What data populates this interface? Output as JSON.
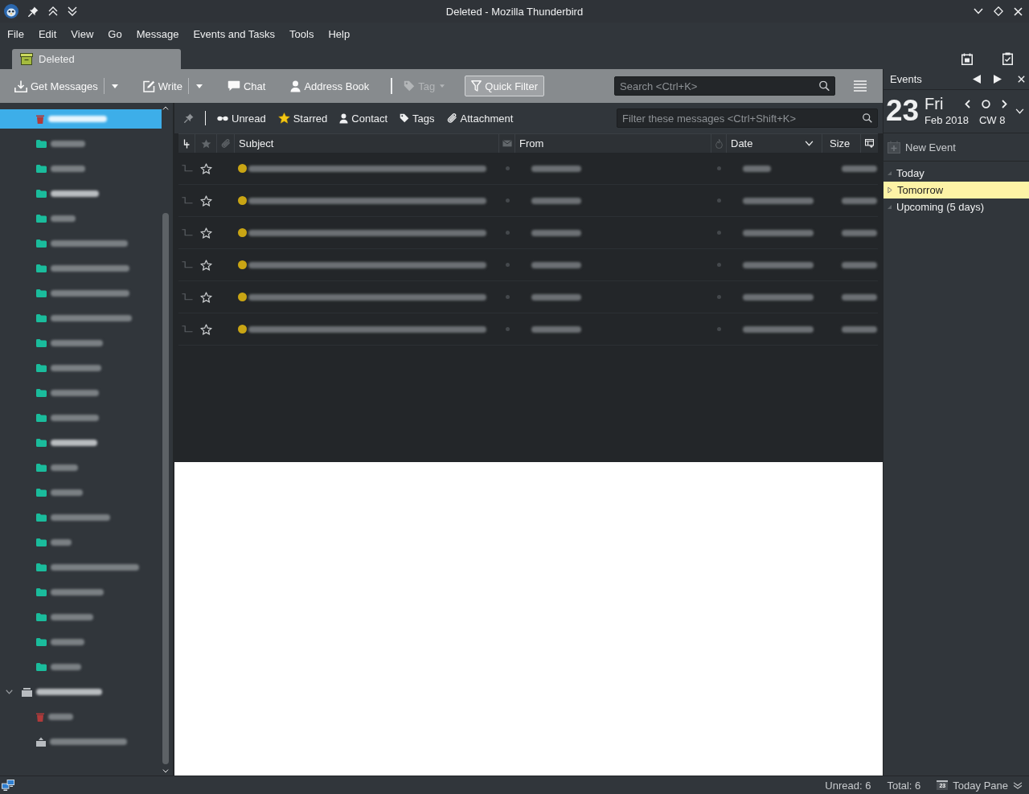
{
  "window": {
    "title": "Deleted - Mozilla Thunderbird"
  },
  "menu": [
    {
      "label": "File"
    },
    {
      "label": "Edit"
    },
    {
      "label": "View"
    },
    {
      "label": "Go"
    },
    {
      "label": "Message"
    },
    {
      "label": "Events and Tasks"
    },
    {
      "label": "Tools"
    },
    {
      "label": "Help"
    }
  ],
  "tabs": [
    {
      "label": "Deleted",
      "selected": true
    }
  ],
  "toolbar": {
    "items": [
      {
        "kind": "button",
        "label": "Get Messages",
        "split_menu": true,
        "dropdown": false,
        "disabled": false,
        "pressed": false
      },
      {
        "kind": "button",
        "label": "Write",
        "split_menu": true,
        "dropdown": false,
        "disabled": false,
        "pressed": false
      },
      {
        "kind": "button",
        "label": "Chat",
        "split_menu": false,
        "dropdown": false,
        "disabled": false,
        "pressed": false
      },
      {
        "kind": "button",
        "label": "Address Book",
        "split_menu": false,
        "dropdown": false,
        "disabled": false,
        "pressed": false
      },
      {
        "kind": "separator"
      },
      {
        "kind": "button",
        "label": "Tag",
        "split_menu": false,
        "dropdown": true,
        "disabled": true,
        "pressed": false
      },
      {
        "kind": "button",
        "label": "Quick Filter",
        "split_menu": false,
        "dropdown": false,
        "disabled": false,
        "pressed": true
      }
    ],
    "search": {
      "placeholder": "Search <Ctrl+K>"
    }
  },
  "folder_pane": {
    "folders": [
      {
        "kind": "trash",
        "selected": true,
        "unread": true
      },
      {
        "kind": "folder",
        "selected": false,
        "unread": false
      },
      {
        "kind": "folder",
        "selected": false,
        "unread": false
      },
      {
        "kind": "folder",
        "selected": false,
        "unread": true
      },
      {
        "kind": "folder",
        "selected": false,
        "unread": false
      },
      {
        "kind": "folder",
        "selected": false,
        "unread": false
      },
      {
        "kind": "folder",
        "selected": false,
        "unread": false
      },
      {
        "kind": "folder",
        "selected": false,
        "unread": false
      },
      {
        "kind": "folder",
        "selected": false,
        "unread": false
      },
      {
        "kind": "folder",
        "selected": false,
        "unread": false
      },
      {
        "kind": "folder",
        "selected": false,
        "unread": false
      },
      {
        "kind": "folder",
        "selected": false,
        "unread": false
      },
      {
        "kind": "folder",
        "selected": false,
        "unread": false
      },
      {
        "kind": "folder",
        "selected": false,
        "unread": true
      },
      {
        "kind": "folder",
        "selected": false,
        "unread": false
      },
      {
        "kind": "folder",
        "selected": false,
        "unread": false
      },
      {
        "kind": "folder",
        "selected": false,
        "unread": false
      },
      {
        "kind": "folder",
        "selected": false,
        "unread": false
      },
      {
        "kind": "folder",
        "selected": false,
        "unread": false
      },
      {
        "kind": "folder",
        "selected": false,
        "unread": false
      },
      {
        "kind": "folder",
        "selected": false,
        "unread": false
      },
      {
        "kind": "folder",
        "selected": false,
        "unread": false
      },
      {
        "kind": "folder",
        "selected": false,
        "unread": false
      }
    ],
    "accounts": [
      {
        "kind": "account",
        "selected": false,
        "expanded": true,
        "children": [
          {
            "kind": "trash",
            "selected": false,
            "unread": false
          },
          {
            "kind": "outbox",
            "selected": false,
            "unread": false
          }
        ]
      }
    ]
  },
  "quick_filter": {
    "buttons": [
      {
        "label": "Unread",
        "selected": false
      },
      {
        "label": "Starred",
        "selected": false
      },
      {
        "label": "Contact",
        "selected": false
      },
      {
        "label": "Tags",
        "selected": false
      },
      {
        "label": "Attachment",
        "selected": false
      }
    ],
    "search": {
      "placeholder": "Filter these messages <Ctrl+Shift+K>"
    }
  },
  "message_list": {
    "columns": [
      {
        "label": "Subject",
        "sorted": false
      },
      {
        "label": "From",
        "sorted": false
      },
      {
        "label": "Date",
        "sorted": true
      },
      {
        "label": "Size",
        "sorted": false
      }
    ],
    "rows": [
      {
        "starred": false
      },
      {
        "starred": false
      },
      {
        "starred": false
      },
      {
        "starred": false
      },
      {
        "starred": false
      },
      {
        "starred": false
      }
    ]
  },
  "today_pane": {
    "title": "Events",
    "day": "23",
    "weekday": "Fri",
    "month_year": "Feb 2018",
    "week": "CW 8",
    "new_event": "New Event",
    "sections": [
      {
        "label": "Today",
        "expanded": true,
        "selected": false
      },
      {
        "label": "Tomorrow",
        "expanded": false,
        "selected": true
      },
      {
        "label": "Upcoming (5 days)",
        "expanded": true,
        "selected": false
      }
    ]
  },
  "status_bar": {
    "unread": "Unread: 6",
    "total": "Total: 6",
    "today_pane_button": {
      "day": "23",
      "label": "Today Pane"
    }
  }
}
